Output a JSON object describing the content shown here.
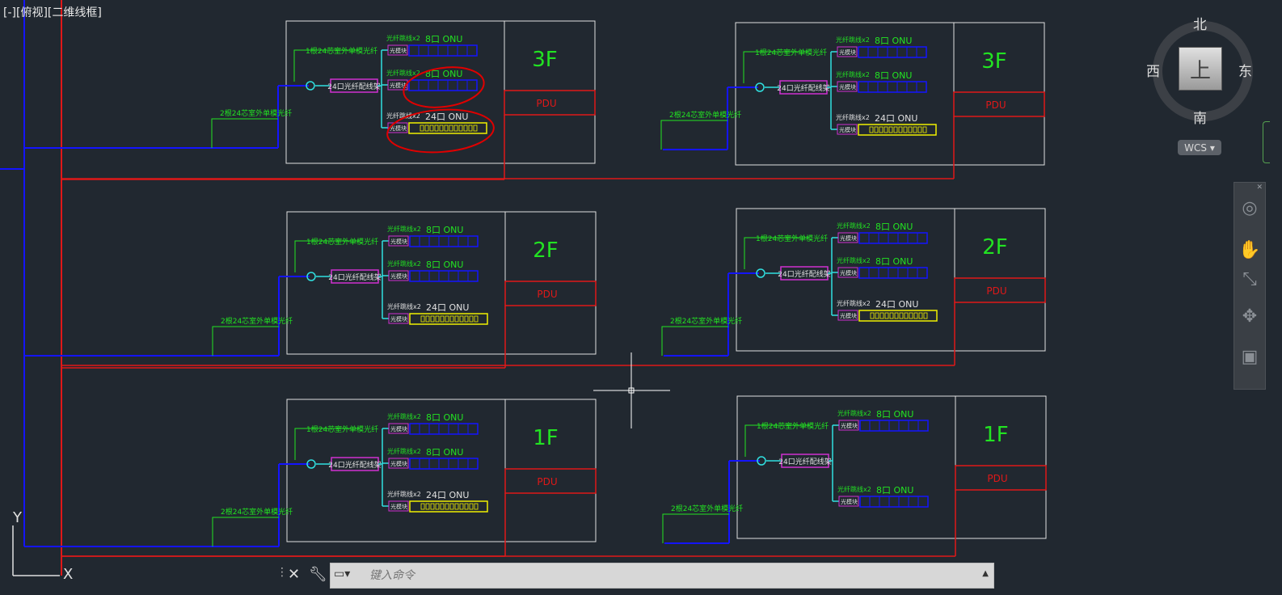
{
  "viewport": {
    "label_parts": [
      "[-]",
      "[俯视]",
      "[二维线框]"
    ]
  },
  "viewcube": {
    "north": "北",
    "south": "南",
    "east": "东",
    "west": "西",
    "face": "上",
    "wcs_label": "WCS"
  },
  "navbar": {
    "tools": [
      "steering-wheel-icon",
      "pan-icon",
      "zoom-icon",
      "orbit-icon",
      "showmotion-icon"
    ]
  },
  "command_line": {
    "placeholder": "键入命令"
  },
  "ucs": {
    "y": "Y",
    "x": "X"
  },
  "panel_text": {
    "riser_24": "1根24芯室外单模光纤",
    "feed_24": "2根24芯室外单模光纤",
    "odf": "24口光纤配线架",
    "patch": "光纤跳线x2",
    "fiber_module": "光模块",
    "onu8": "8口 ONU",
    "onu24": "24口 ONU",
    "pdu": "PDU"
  },
  "panels": [
    {
      "floor": "3F",
      "rows": [
        "onu8",
        "onu8",
        "onu24"
      ]
    },
    {
      "floor": "3F",
      "rows": [
        "onu8",
        "onu8",
        "onu24"
      ]
    },
    {
      "floor": "2F",
      "rows": [
        "onu8",
        "onu8",
        "onu24"
      ]
    },
    {
      "floor": "2F",
      "rows": [
        "onu8",
        "onu8",
        "onu24"
      ]
    },
    {
      "floor": "1F",
      "rows": [
        "onu8",
        "onu8",
        "onu24"
      ]
    },
    {
      "floor": "1F",
      "rows": [
        "onu8",
        "onu8"
      ]
    }
  ],
  "colors": {
    "background": "#212830",
    "frame": "#e0e0e0",
    "label_green": "#22e322",
    "cable_blue": "#1414ff",
    "power_red": "#e01818",
    "odf_magenta": "#d030d0",
    "fiber_cyan": "#30e0e0",
    "switch_yellow": "#f0f000",
    "markup_red": "#e00000"
  }
}
